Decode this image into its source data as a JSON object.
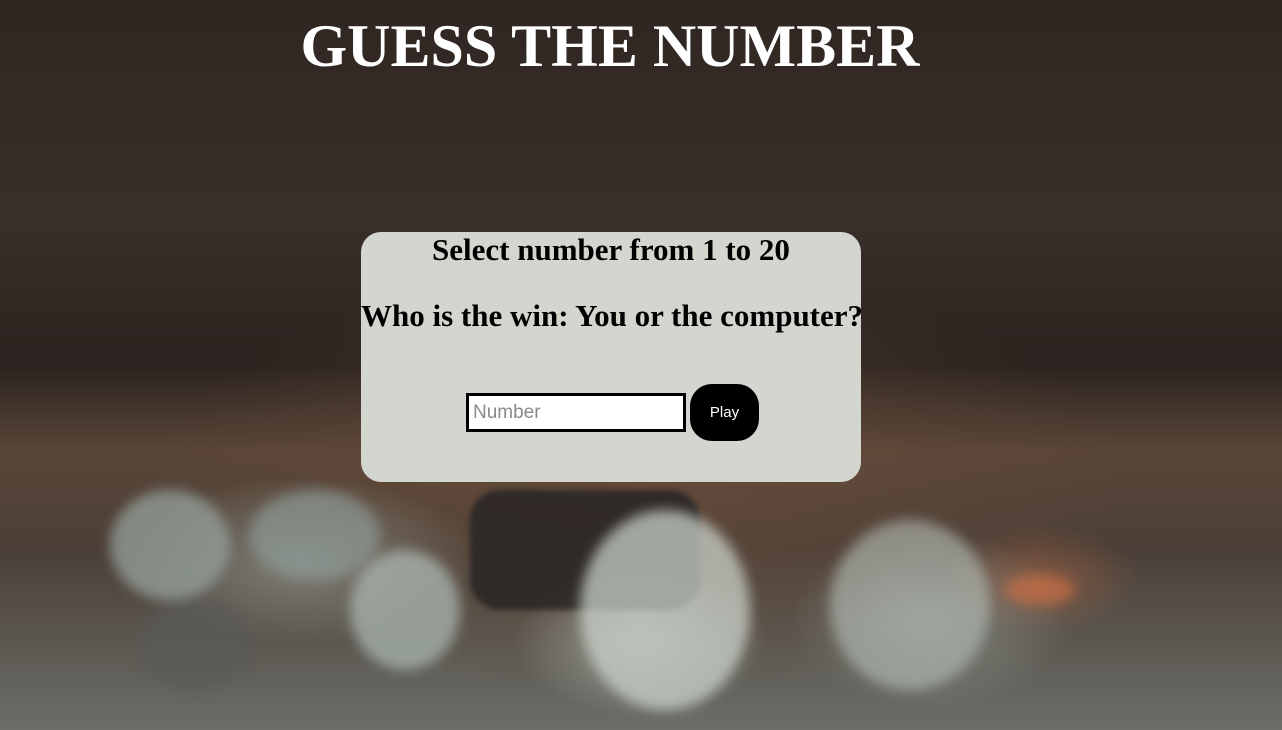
{
  "header": {
    "title": "GUESS THE NUMBER"
  },
  "game": {
    "instruction": "Select number from 1 to 20",
    "question": "Who is the win: You or the computer?",
    "input": {
      "placeholder": "Number",
      "value": ""
    },
    "play_label": "Play"
  },
  "colors": {
    "card_background": "#d3d5cf",
    "button_background": "#000000",
    "title_color": "#ffffff"
  }
}
